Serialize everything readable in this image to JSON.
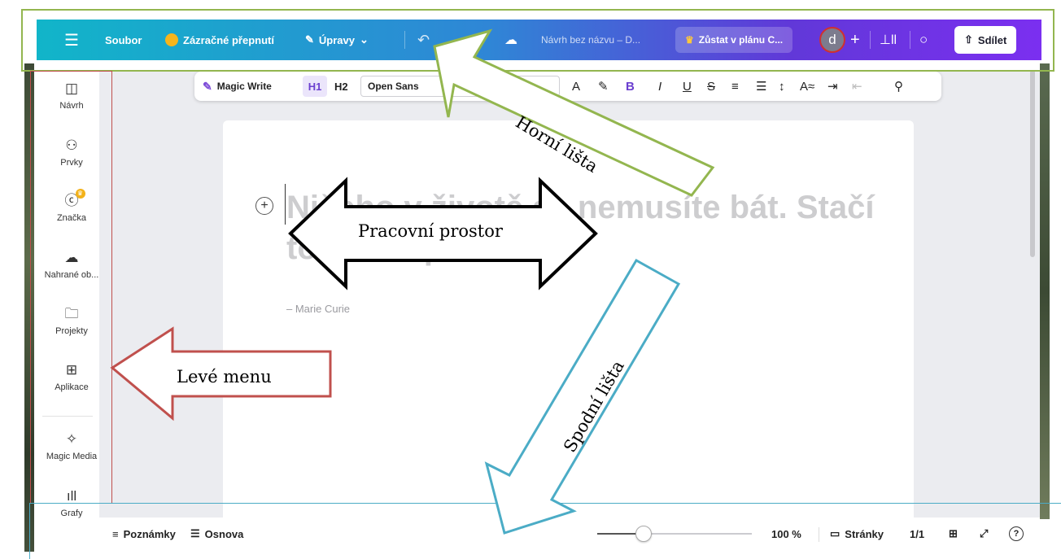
{
  "topbar": {
    "menu_icon": "hamburger-icon",
    "file": "Soubor",
    "magic_switch": "Zázračné přepnutí",
    "edit": "Úpravy",
    "edit_icon": "pencil-icon",
    "chevron": "⌄",
    "undo_icon": "undo-icon",
    "cloud_icon": "cloud-check-icon",
    "doc_title": "Návrh bez názvu – D...",
    "plan": "Zůstat v plánu C...",
    "plan_crown": "♛",
    "avatar_letter": "d",
    "plus": "+",
    "analytics_icon": "bar-chart-icon",
    "comment_icon": "comment-icon",
    "share": "Sdílet",
    "share_icon": "share-upload-icon"
  },
  "sidebar": {
    "items": [
      {
        "label": "Návrh",
        "icon": "design-icon",
        "glyph": "◫"
      },
      {
        "label": "Prvky",
        "icon": "elements-icon",
        "glyph": "⚇"
      },
      {
        "label": "Značka",
        "icon": "brand-icon",
        "glyph": "ⓒ"
      },
      {
        "label": "Nahrané ob...",
        "icon": "upload-cloud-icon",
        "glyph": "☁"
      },
      {
        "label": "Projekty",
        "icon": "folder-icon",
        "glyph": "🗀"
      },
      {
        "label": "Aplikace",
        "icon": "apps-icon",
        "glyph": "⊞"
      },
      {
        "label": "Magic Media",
        "icon": "magic-media-icon",
        "glyph": "✧"
      },
      {
        "label": "Grafy",
        "icon": "chart-icon",
        "glyph": "ıll"
      }
    ]
  },
  "text_toolbar": {
    "magic_write": "Magic Write",
    "h1": "H1",
    "h2": "H2",
    "font": "Open Sans",
    "buttons": [
      "A",
      "✎",
      "B",
      "I",
      "U",
      "S",
      "≡",
      "☰",
      "↕",
      "A≈",
      "⇥",
      "⇤",
      "⚲"
    ]
  },
  "document": {
    "quote": "Ničeho v životě se nemusíte bát. Stačí to pochopit.",
    "author": "– Marie Curie",
    "add_icon": "+"
  },
  "bottombar": {
    "notes": "Poznámky",
    "outline": "Osnova",
    "zoom": "100 %",
    "zoom_fraction": 0.3,
    "pages": "Stránky",
    "page_count": "1/1",
    "grid_icon": "grid-icon",
    "fullscreen_icon": "expand-icon",
    "help": "?"
  },
  "annotations": {
    "top": "Horní lišta",
    "workspace": "Pracovní prostor",
    "left": "Levé menu",
    "bottom": "Spodní lišta",
    "colors": {
      "top": "#93b64f",
      "left": "#c0504d",
      "bottom": "#4bacc6",
      "workspace": "#000000"
    }
  }
}
